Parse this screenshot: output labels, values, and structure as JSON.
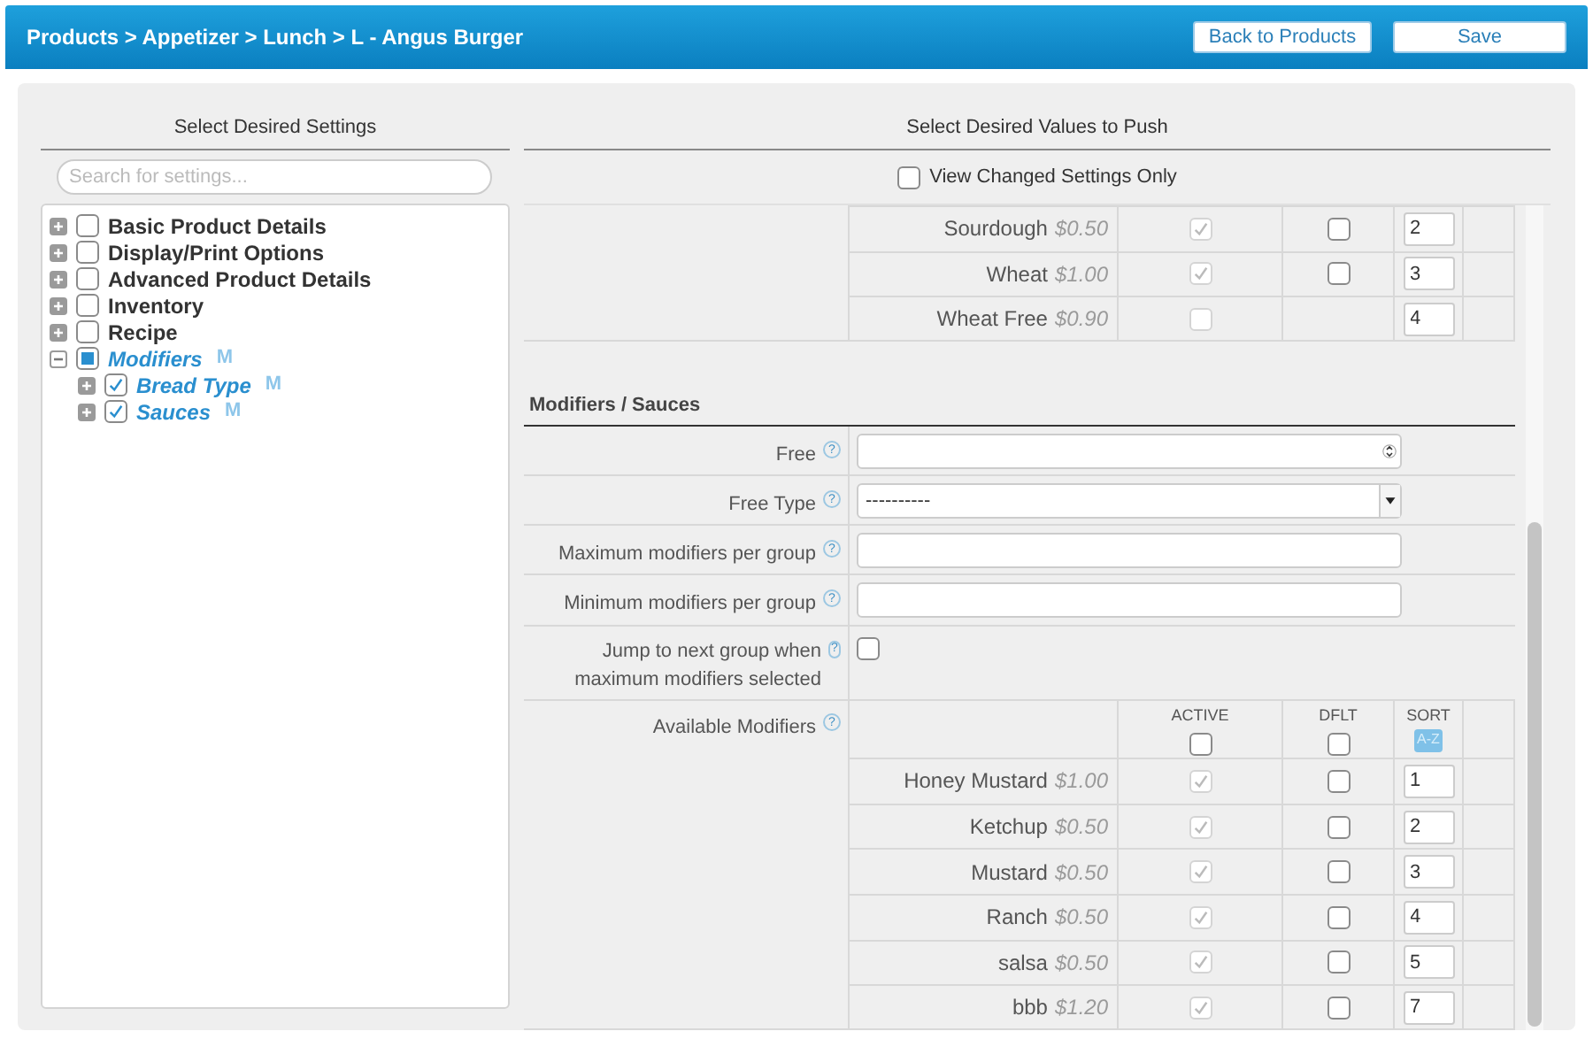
{
  "header": {
    "breadcrumb": "Products > Appetizer > Lunch > L - Angus Burger",
    "buttons": [
      "Back to Products",
      "Save"
    ]
  },
  "left": {
    "title": "Select Desired Settings",
    "search": {
      "placeholder": "Search for settings..."
    },
    "tree": [
      {
        "label": "Basic Product Details",
        "expanded": false,
        "checked": false
      },
      {
        "label": "Display/Print Options",
        "expanded": false,
        "checked": false
      },
      {
        "label": "Advanced Product Details",
        "expanded": false,
        "checked": false
      },
      {
        "label": "Inventory",
        "expanded": false,
        "checked": false
      },
      {
        "label": "Recipe",
        "expanded": false,
        "checked": false
      },
      {
        "label": "Modifiers",
        "expanded": true,
        "checked": false,
        "partial": true,
        "badge": "M",
        "children": [
          {
            "label": "Bread Type",
            "expanded": false,
            "checked": true,
            "badge": "M"
          },
          {
            "label": "Sauces",
            "expanded": false,
            "checked": true,
            "badge": "M"
          }
        ]
      }
    ]
  },
  "right": {
    "title": "Select Desired Values to Push",
    "view_changed": {
      "label": "View Changed Settings Only",
      "checked": false
    },
    "top_rows": [
      {
        "name": "Sourdough",
        "price": "$0.50",
        "active": true,
        "default": false,
        "sort": "2"
      },
      {
        "name": "Wheat",
        "price": "$1.00",
        "active": true,
        "default": false,
        "sort": "3"
      },
      {
        "name": "Wheat Free",
        "price": "$0.90",
        "active": false,
        "sort": "4"
      }
    ],
    "section": {
      "title": "Modifiers / Sauces",
      "fields": [
        {
          "label": "Free",
          "help": "?",
          "kind": "spinner"
        },
        {
          "label": "Free Type",
          "help": "?",
          "kind": "select",
          "value": "----------"
        },
        {
          "label": "Maximum modifiers per group",
          "help": "?",
          "kind": "text"
        },
        {
          "label": "Minimum modifiers per group",
          "help": "?",
          "kind": "text"
        },
        {
          "label": "Jump to next group when maximum modifiers selected",
          "help": "?",
          "kind": "checkbox",
          "checked": false
        }
      ],
      "modifiers": {
        "label": "Available Modifiers",
        "help": "?",
        "columns": [
          "ACTIVE",
          "DFLT",
          "SORT"
        ],
        "active_all": false,
        "default_all": false,
        "sort_button": "A-Z",
        "rows": [
          {
            "name": "Honey Mustard",
            "price": "$1.00",
            "active": true,
            "default": false,
            "sort": "1"
          },
          {
            "name": "Ketchup",
            "price": "$0.50",
            "active": true,
            "default": false,
            "sort": "2"
          },
          {
            "name": "Mustard",
            "price": "$0.50",
            "active": true,
            "default": false,
            "sort": "3"
          },
          {
            "name": "Ranch",
            "price": "$0.50",
            "active": true,
            "default": false,
            "sort": "4"
          },
          {
            "name": "salsa",
            "price": "$0.50",
            "active": true,
            "default": false,
            "sort": "5"
          },
          {
            "name": "bbb",
            "price": "$1.20",
            "active": true,
            "default": false,
            "sort": "7"
          }
        ]
      }
    }
  }
}
